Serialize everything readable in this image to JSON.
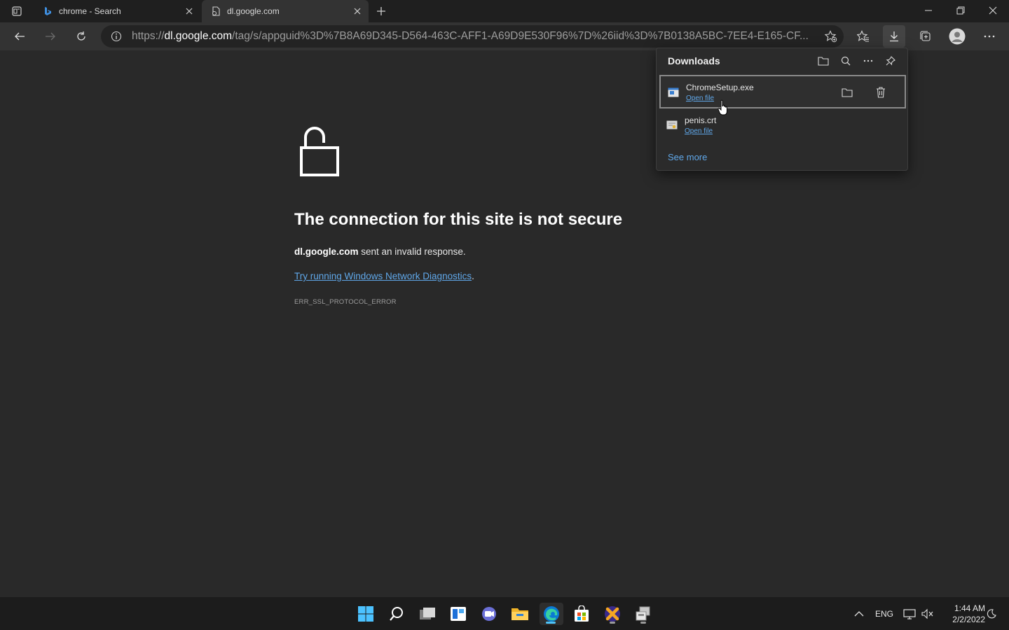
{
  "browser": {
    "tabs": [
      {
        "title": "chrome - Search",
        "favicon": "bing-icon",
        "active": false
      },
      {
        "title": "dl.google.com",
        "favicon": "broken-page-icon",
        "active": true
      }
    ],
    "address": {
      "url_prefix": "https://",
      "url_host": "dl.google.com",
      "url_rest": "/tag/s/appguid%3D%7B8A69D345-D564-463C-AFF1-A69D9E530F96%7D%26iid%3D%7B0138A5BC-7EE4-E165-CF..."
    }
  },
  "error_page": {
    "title": "The connection for this site is not secure",
    "host": "dl.google.com",
    "desc_rest": " sent an invalid response.",
    "link_text": "Try running Windows Network Diagnostics",
    "link_suffix": ".",
    "code": "ERR_SSL_PROTOCOL_ERROR"
  },
  "downloads": {
    "heading": "Downloads",
    "items": [
      {
        "name": "ChromeSetup.exe",
        "action": "Open file",
        "icon": "exe-file-icon",
        "selected": true
      },
      {
        "name": "penis.crt",
        "action": "Open file",
        "icon": "certificate-file-icon",
        "selected": false
      }
    ],
    "see_more": "See more"
  },
  "taskbar": {
    "language": "ENG",
    "time": "1:44 AM",
    "date": "2/2/2022"
  },
  "colors": {
    "background": "#292929",
    "link": "#60a8ea",
    "edge_accent": "#4fc3f7"
  }
}
